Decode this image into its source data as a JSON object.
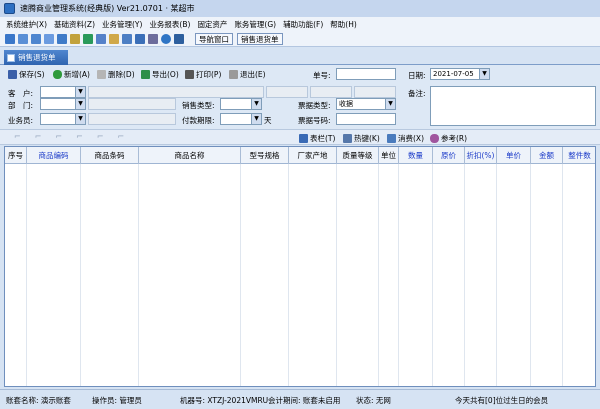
{
  "window": {
    "title": "速腾商业管理系统(经典版) Ver21.0701 · 某超市"
  },
  "menu": [
    "系统维护(X)",
    "基础资料(Z)",
    "业务管理(Y)",
    "业务报表(B)",
    "固定资产",
    "账务管理(G)",
    "辅助功能(F)",
    "帮助(H)"
  ],
  "toolbar": {
    "nav_window": "导航窗口",
    "sales_return_doc": "销售退货单"
  },
  "tab": {
    "label": "销售退货单"
  },
  "actions": {
    "save": "保存(S)",
    "add": "新增(A)",
    "delete": "删除(D)",
    "export": "导出(O)",
    "print": "打印(P)",
    "exit": "退出(E)"
  },
  "form": {
    "doc_no_label": "单号:",
    "date_label": "日期:",
    "date_value": "2021-07-05",
    "customer_label": "客　户:",
    "remark_label": "备注:",
    "dept_label": "部　门:",
    "sales_type_label": "销售类型:",
    "invoice_type_label": "票据类型:",
    "invoice_type_value": "收据",
    "salesman_label": "业务员:",
    "pay_term_label": "付款期限:",
    "day_unit": "天",
    "invoice_no_label": "票据号码:"
  },
  "subtool": {
    "table_bar": "表栏(T)",
    "hotkey": "热键(K)",
    "consume": "消费(X)",
    "reference": "参考(R)"
  },
  "grid": {
    "columns": [
      "序号",
      "商品编码",
      "商品条码",
      "商品名称",
      "型号规格",
      "厂家产地",
      "质量等级",
      "单位",
      "数量",
      "原价",
      "折扣(%)",
      "单价",
      "金额",
      "整件数"
    ],
    "blue_columns": [
      "商品编码",
      "数量",
      "原价",
      "折扣(%)",
      "单价",
      "金额",
      "整件数"
    ]
  },
  "status": {
    "account": "账套名称: 演示账套",
    "operator": "操作员: 管理员",
    "machine": "机器号: XTZJ-2021VMRU",
    "period": "会计期间: 账套未启用",
    "state": "状态: 无网",
    "birthday": "今天共有[0]位过生日的会员"
  }
}
